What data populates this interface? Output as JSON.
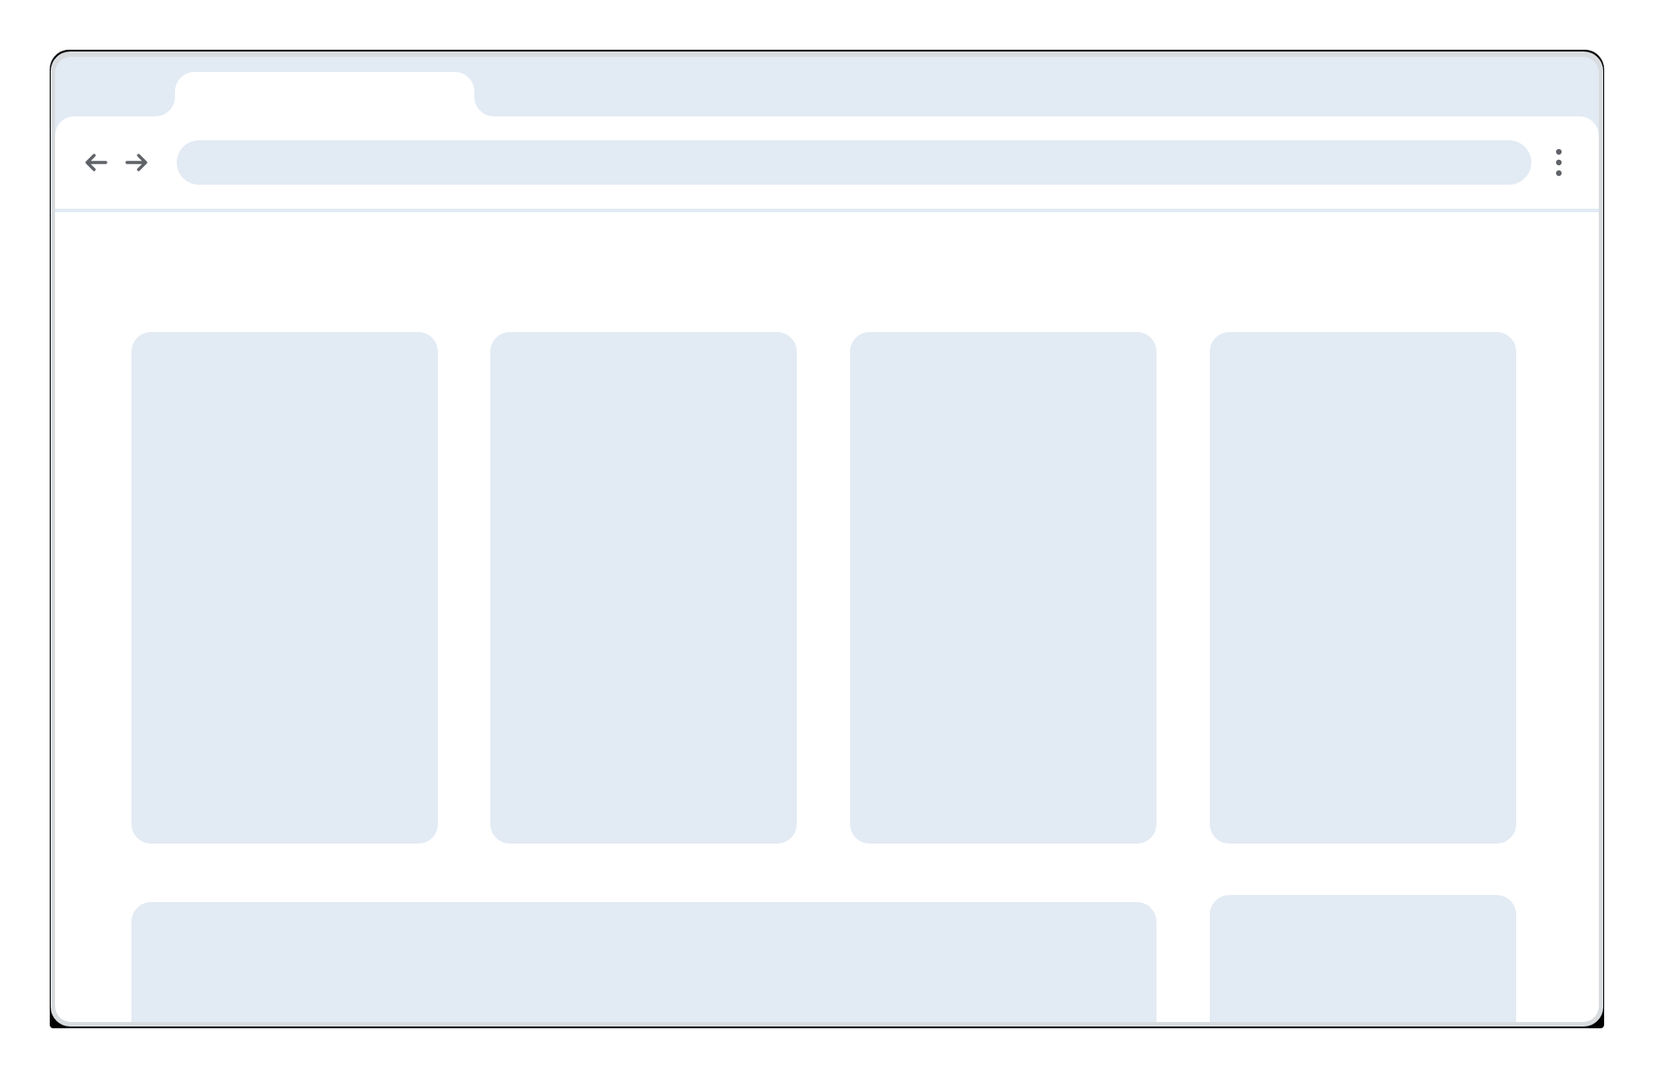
{
  "browser": {
    "tab": {
      "title": ""
    },
    "toolbar": {
      "back_icon": "arrow-left-icon",
      "forward_icon": "arrow-right-icon",
      "menu_icon": "kebab-menu-icon",
      "address_value": "",
      "address_placeholder": ""
    }
  },
  "page": {
    "cards": [
      {
        "label": ""
      },
      {
        "label": ""
      },
      {
        "label": ""
      },
      {
        "label": ""
      },
      {
        "label": ""
      },
      {
        "label": ""
      }
    ]
  },
  "colors": {
    "placeholder": "#e2eaf3",
    "icon": "#5f6368",
    "frame": "#000000"
  }
}
